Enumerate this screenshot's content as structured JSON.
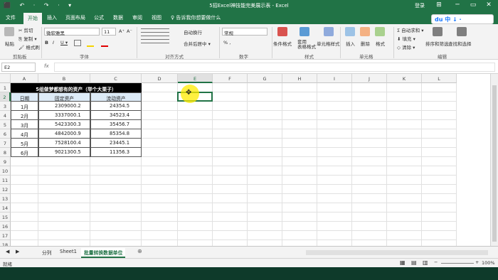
{
  "window": {
    "title": "5招Excel神技能完美展示表 - Excel",
    "login": "登录",
    "min": "─",
    "restore": "▭",
    "close": "✕",
    "ribbon_display": "⊞"
  },
  "quick_access": "⬛ ↶ · ↷ · ▾",
  "tabs": [
    "文件",
    "开始",
    "插入",
    "页面布局",
    "公式",
    "数据",
    "审阅",
    "视图"
  ],
  "tell_me": "♀ 告诉我你想要做什么",
  "ribbon": {
    "clipboard": {
      "cut": "✂ 剪切",
      "copy": "⎘ 复制 ▾",
      "painter": "🖌 格式刷",
      "paste": "粘贴",
      "group": "剪贴板"
    },
    "font": {
      "name": "微软雅黑",
      "size": "11",
      "grow": "A⁺",
      "shrink": "A⁻",
      "bold": "B",
      "italic": "I",
      "underline": "U ▾",
      "group": "字体"
    },
    "alignment": {
      "wrap": "自动换行",
      "merge": "合并后居中 ▾",
      "group": "对齐方式"
    },
    "number": {
      "format": "常规",
      "pct": "% ,",
      "group": "数字"
    },
    "styles": {
      "cond": "条件格式",
      "table": "套用\n表格格式",
      "cell": "单元格样式",
      "group": "样式"
    },
    "cells": {
      "insert": "插入",
      "delete": "删除",
      "format": "格式",
      "group": "单元格"
    },
    "editing": {
      "autosum": "Σ 自动求和 ▾",
      "fill": "⬇ 填充 ▾",
      "clear": "◇ 清除 ▾",
      "sort": "排序和筛选",
      "find": "查找和选择",
      "group": "编辑"
    },
    "brand": "du 中 ↓ ·"
  },
  "formula_bar": {
    "name_box": "E2",
    "fx": "fx"
  },
  "columns": [
    "A",
    "B",
    "C",
    "D",
    "E",
    "F",
    "G",
    "H",
    "I",
    "J",
    "K",
    "L"
  ],
  "rows": [
    "1",
    "2",
    "3",
    "4",
    "5",
    "6",
    "7",
    "8",
    "9",
    "10",
    "11",
    "12",
    "13",
    "14",
    "15",
    "16",
    "17",
    "18"
  ],
  "table": {
    "title": "5组做梦都想有的资产（举个大栗子）",
    "headers": [
      "日期",
      "固定资产",
      "流动资产"
    ],
    "data": [
      [
        "1月",
        "2309000.2",
        "24354.5"
      ],
      [
        "2月",
        "3337000.1",
        "34523.4"
      ],
      [
        "3月",
        "5423300.3",
        "35456.7"
      ],
      [
        "4月",
        "4842000.9",
        "85354.8"
      ],
      [
        "5月",
        "7528100.4",
        "23445.1"
      ],
      [
        "6月",
        "9021300.5",
        "11356.3"
      ]
    ]
  },
  "sheets": [
    "分列",
    "Sheet1",
    "批量转换数据单位"
  ],
  "active_sheet": 2,
  "status": {
    "ready": "就绪",
    "zoom": "100%",
    "zoom_minus": "−",
    "zoom_plus": "+"
  },
  "accent": "#217346"
}
